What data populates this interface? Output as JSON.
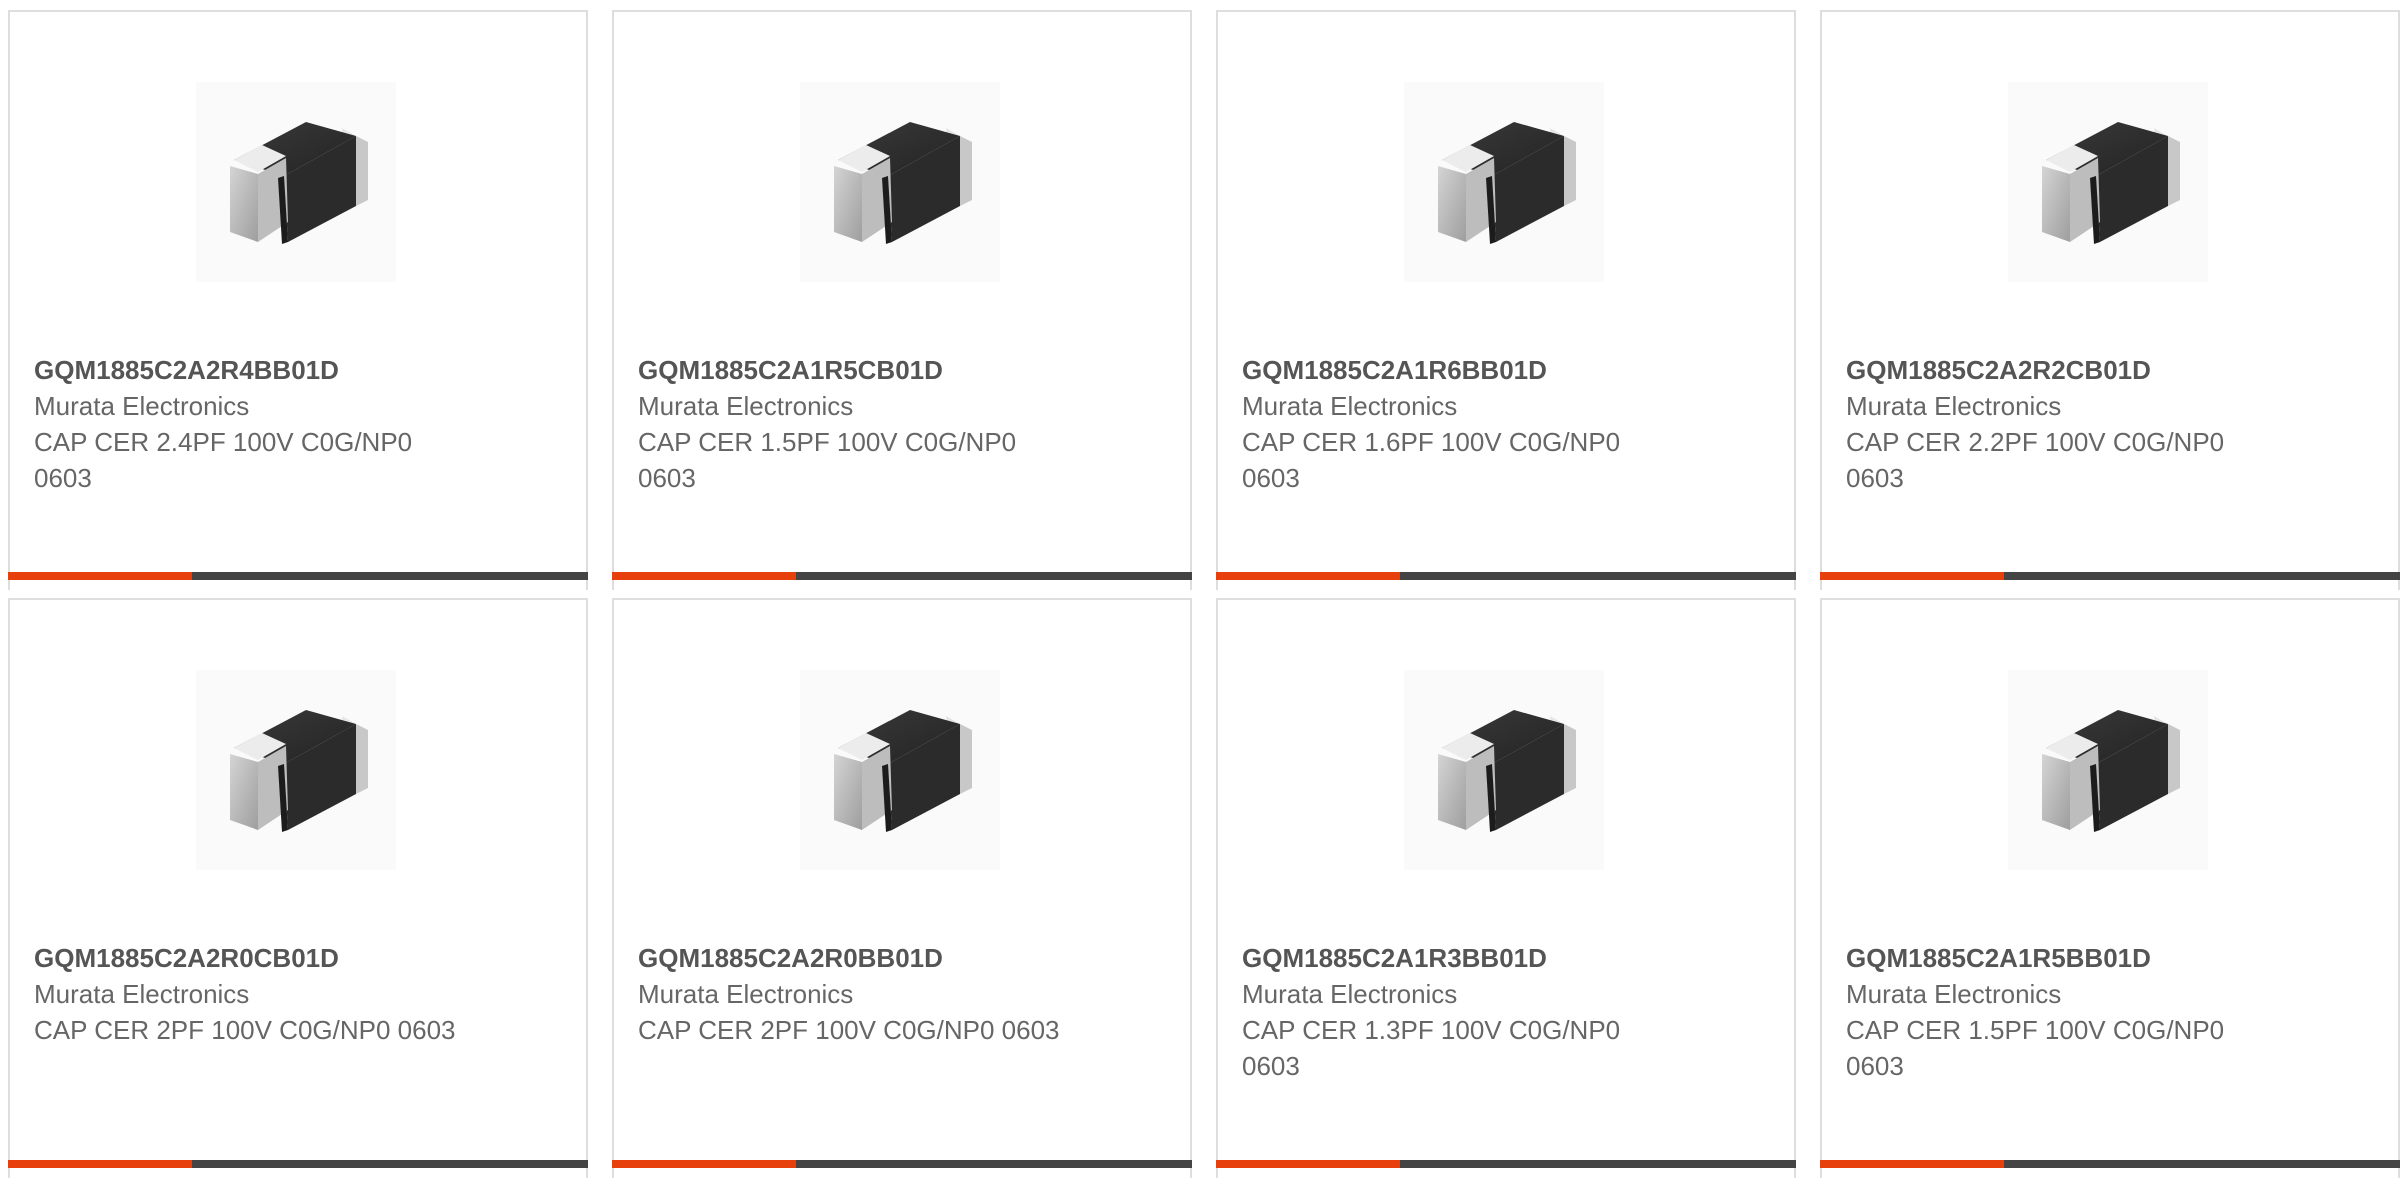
{
  "colors": {
    "accent": "#e8400c",
    "bar": "#444444",
    "border": "#dedede"
  },
  "icon": "capacitor-chip-icon",
  "products": [
    {
      "part": "GQM1885C2A2R4BB01D",
      "manufacturer": "Murata Electronics",
      "description": "CAP CER 2.4PF 100V C0G/NP0 0603"
    },
    {
      "part": "GQM1885C2A1R5CB01D",
      "manufacturer": "Murata Electronics",
      "description": "CAP CER 1.5PF 100V C0G/NP0 0603"
    },
    {
      "part": "GQM1885C2A1R6BB01D",
      "manufacturer": "Murata Electronics",
      "description": "CAP CER 1.6PF 100V C0G/NP0 0603"
    },
    {
      "part": "GQM1885C2A2R2CB01D",
      "manufacturer": "Murata Electronics",
      "description": "CAP CER 2.2PF 100V C0G/NP0 0603"
    },
    {
      "part": "GQM1885C2A2R0CB01D",
      "manufacturer": "Murata Electronics",
      "description": "CAP CER 2PF 100V C0G/NP0 0603"
    },
    {
      "part": "GQM1885C2A2R0BB01D",
      "manufacturer": "Murata Electronics",
      "description": "CAP CER 2PF 100V C0G/NP0 0603"
    },
    {
      "part": "GQM1885C2A1R3BB01D",
      "manufacturer": "Murata Electronics",
      "description": "CAP CER 1.3PF 100V C0G/NP0 0603"
    },
    {
      "part": "GQM1885C2A1R5BB01D",
      "manufacturer": "Murata Electronics",
      "description": "CAP CER 1.5PF 100V C0G/NP0 0603"
    }
  ]
}
